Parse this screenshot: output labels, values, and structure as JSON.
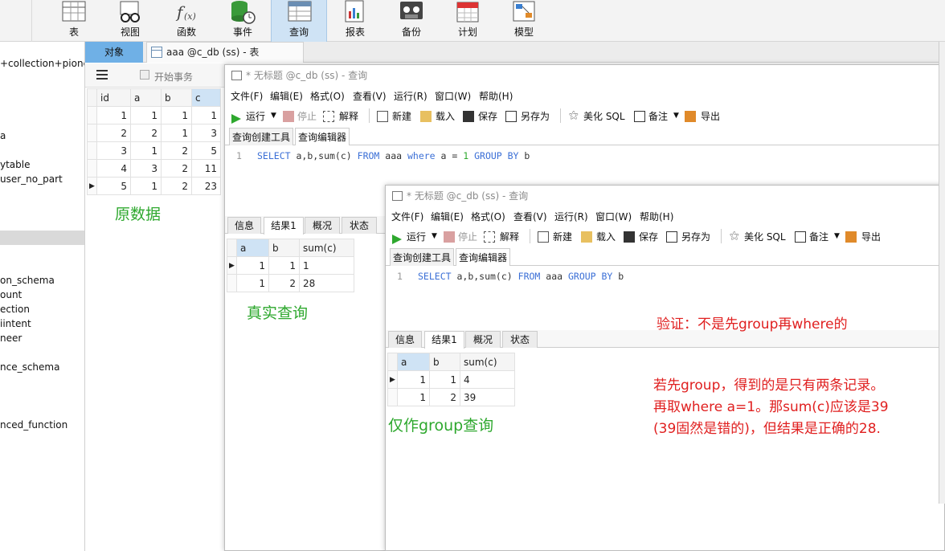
{
  "ribbon": {
    "buttons": [
      "表",
      "视图",
      "函数",
      "事件",
      "查询",
      "报表",
      "备份",
      "计划",
      "模型"
    ],
    "active": "查询"
  },
  "tabs": {
    "objects": "对象",
    "table_tab": "aaa @c_db (ss) - 表"
  },
  "tree": {
    "items": [
      "+collection+pionee",
      "a",
      "ytable",
      "user_no_part",
      "on_schema",
      "ount",
      "ection",
      "iintent",
      "neer",
      "nce_schema",
      "nced_function"
    ]
  },
  "table_view": {
    "toolbar_begin": "开始事务",
    "columns": [
      "id",
      "a",
      "b",
      "c"
    ],
    "rows": [
      [
        "1",
        "1",
        "1",
        "1"
      ],
      [
        "2",
        "2",
        "1",
        "3"
      ],
      [
        "3",
        "1",
        "2",
        "5"
      ],
      [
        "4",
        "3",
        "2",
        "11"
      ],
      [
        "5",
        "1",
        "2",
        "23"
      ]
    ]
  },
  "annotations": {
    "original_data": "原数据",
    "real_query": "真实查询",
    "group_only": "仅作group查询",
    "verify": "验证：不是先group再where的",
    "explain_1": "若先group，得到的是只有两条记录。",
    "explain_2": "再取where a=1。那sum(c)应该是39",
    "explain_3": "(39固然是错的)，但结果是正确的28."
  },
  "query_window": {
    "title": "* 无标题 @c_db (ss) - 查询",
    "menu": [
      "文件(F)",
      "编辑(E)",
      "格式(O)",
      "查看(V)",
      "运行(R)",
      "窗口(W)",
      "帮助(H)"
    ],
    "toolbar": {
      "run": "运行",
      "stop": "停止",
      "explain": "解释",
      "new": "新建",
      "load": "载入",
      "save": "保存",
      "save_as": "另存为",
      "beautify": "美化 SQL",
      "note": "备注",
      "export": "导出"
    },
    "subtabs": [
      "查询创建工具",
      "查询编辑器"
    ],
    "result_tabs": [
      "信息",
      "结果1",
      "概况",
      "状态"
    ],
    "result_columns": [
      "a",
      "b",
      "sum(c)"
    ]
  },
  "query1": {
    "line_no": "1",
    "sql_parts": [
      "SELECT",
      " a,b,sum(c) ",
      "FROM",
      " aaa ",
      "where",
      " a = ",
      "1",
      " ",
      "GROUP BY",
      " b"
    ],
    "rows": [
      [
        "1",
        "1",
        "1"
      ],
      [
        "1",
        "2",
        "28"
      ]
    ]
  },
  "query2": {
    "line_no": "1",
    "sql_parts": [
      "SELECT",
      " a,b,sum(c) ",
      "FROM",
      " aaa ",
      "GROUP BY",
      " b"
    ],
    "rows": [
      [
        "1",
        "1",
        "4"
      ],
      [
        "1",
        "2",
        "39"
      ]
    ]
  }
}
